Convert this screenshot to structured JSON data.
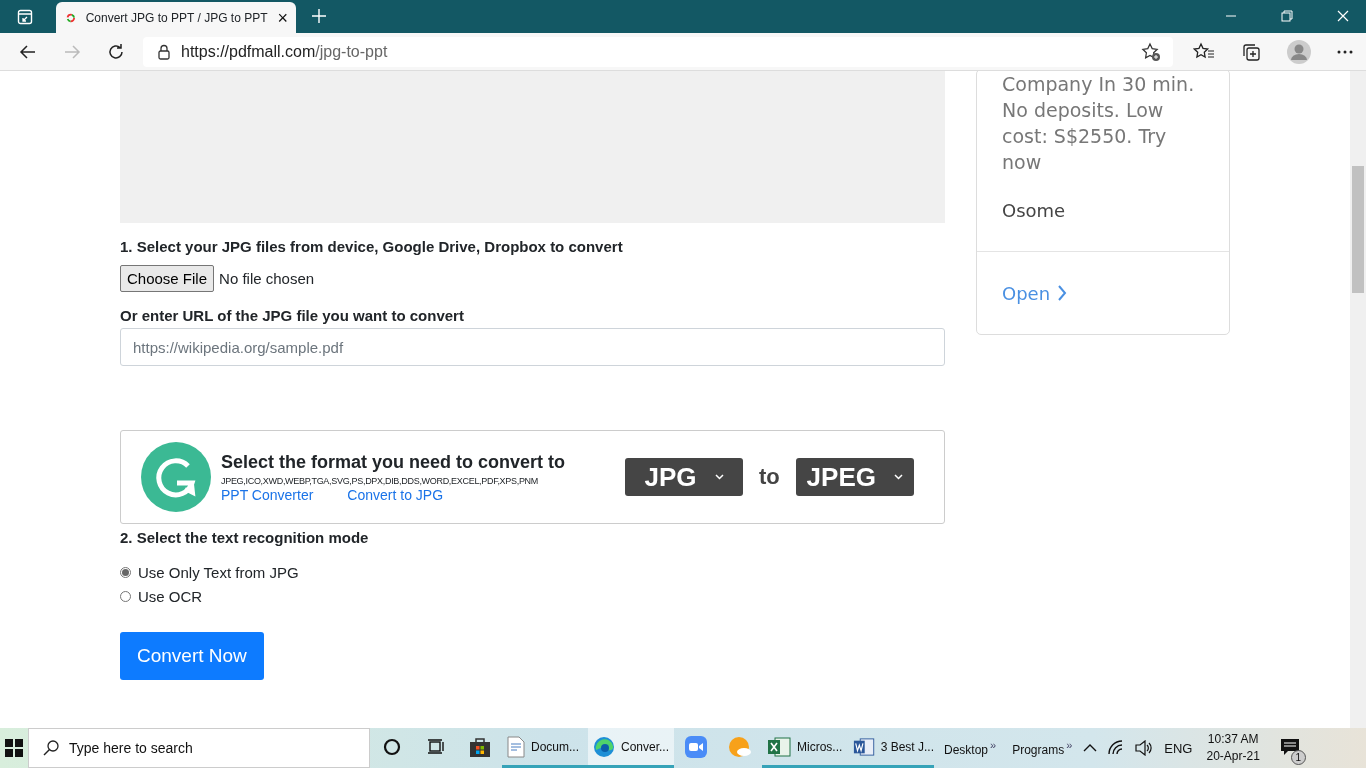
{
  "browser": {
    "tab": {
      "title": "Convert JPG to PPT / JPG to PPT",
      "close": "×"
    },
    "url": {
      "host": "https://pdfmall.com",
      "path": "/jpg-to-ppt"
    }
  },
  "step1": {
    "heading": "1. Select your JPG files from device, Google Drive, Dropbox to convert",
    "choose_button": "Choose File",
    "file_status": "No file chosen"
  },
  "url_input": {
    "label": "Or enter URL of the JPG file you want to convert",
    "placeholder": "https://wikipedia.org/sample.pdf"
  },
  "format_box": {
    "title": "Select the format you need to convert to",
    "formats": "JPEG,ICO,XWD,WEBP,TGA,SVG,PS,DPX,DIB,DDS,WORD,EXCEL,PDF,XPS,PNM",
    "links": [
      "PPT Converter",
      "Convert to JPG"
    ],
    "from": "JPG",
    "joiner": "to",
    "to": "JPEG"
  },
  "step2": {
    "heading": "2. Select the text recognition mode",
    "options": [
      {
        "label": "Use Only Text from JPG",
        "selected": true
      },
      {
        "label": "Use OCR",
        "selected": false
      }
    ]
  },
  "convert_button": "Convert Now",
  "ad": {
    "text": "Company In 30 min. No deposits. Low cost: S$2550. Try now",
    "advertiser": "Osome",
    "link": "Open"
  },
  "taskbar": {
    "search_placeholder": "Type here to search",
    "apps": [
      {
        "kind": "cortana"
      },
      {
        "kind": "taskview"
      },
      {
        "kind": "store",
        "running": false
      },
      {
        "kind": "document",
        "label": "Docum...",
        "running": true,
        "selected": false
      },
      {
        "kind": "edge",
        "label": "Conver...",
        "running": true,
        "selected": true
      },
      {
        "kind": "zoom",
        "running": false
      },
      {
        "kind": "weather",
        "running": false
      },
      {
        "kind": "excel",
        "label": "Micros...",
        "running": true,
        "selected": false
      },
      {
        "kind": "word",
        "label": "3 Best J...",
        "running": true,
        "selected": false
      }
    ],
    "toolbars": [
      {
        "label": "Desktop",
        "chevron": "»"
      },
      {
        "label": "Programs",
        "chevron": "»"
      }
    ],
    "language": "ENG",
    "time": "10:37 AM",
    "date": "20-Apr-21",
    "notifications": "1"
  }
}
